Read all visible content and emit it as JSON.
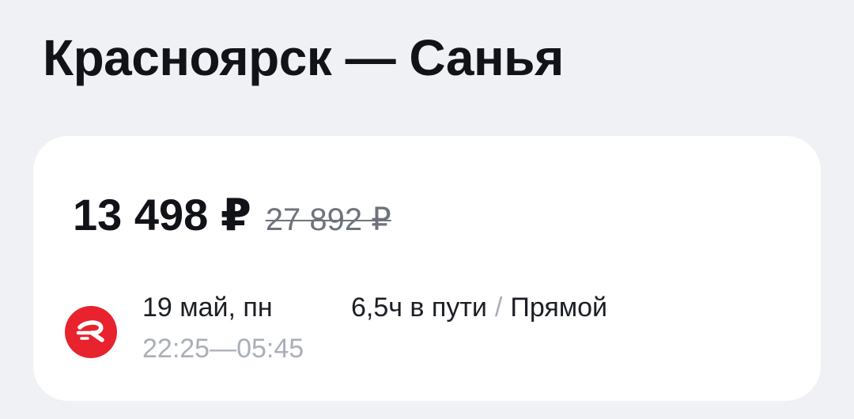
{
  "page": {
    "title": "Красноярск — Санья"
  },
  "ticket": {
    "price": "13 498 ₽",
    "old_price": "27 892 ₽",
    "airline_logo_icon": "red-circle-r-logo-icon",
    "date": "19 май, пн",
    "time": "22:25—05:45",
    "duration": "6,5ч в пути",
    "separator": "/",
    "stops": "Прямой"
  },
  "colors": {
    "background": "#eff1f5",
    "card": "#ffffff",
    "logo_red": "#e8232e",
    "muted_text": "#a9aeb8"
  }
}
